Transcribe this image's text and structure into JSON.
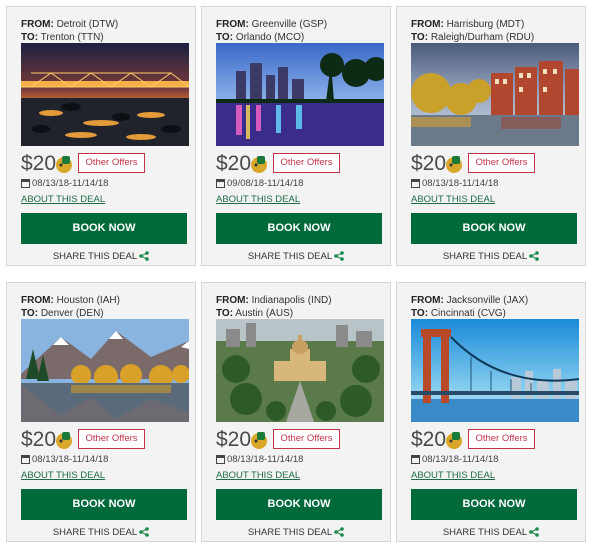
{
  "labels": {
    "from": "FROM:",
    "to": "TO:",
    "other_offers": "Other Offers",
    "about": "ABOUT THIS DEAL",
    "book": "BOOK NOW",
    "share": "SHARE THIS DEAL"
  },
  "colors": {
    "book_button": "#006a3a",
    "offers_border": "#c3344a",
    "about_link": "#1e6b46",
    "share_icon": "#1a8a4a",
    "card_bg": "#f3f3f3"
  },
  "deals": [
    {
      "from": "Detroit (DTW)",
      "to": "Trenton (TTN)",
      "price": "$20",
      "dates": "08/13/18-11/14/18",
      "photo": "bridge-sunset"
    },
    {
      "from": "Greenville (GSP)",
      "to": "Orlando (MCO)",
      "price": "$20",
      "dates": "09/08/18-11/14/18",
      "photo": "city-night-lake"
    },
    {
      "from": "Harrisburg (MDT)",
      "to": "Raleigh/Durham (RDU)",
      "price": "$20",
      "dates": "08/13/18-11/14/18",
      "photo": "riverside-buildings"
    },
    {
      "from": "Houston (IAH)",
      "to": "Denver (DEN)",
      "price": "$20",
      "dates": "08/13/18-11/14/18",
      "photo": "mountain-lake-autumn"
    },
    {
      "from": "Indianapolis (IND)",
      "to": "Austin (AUS)",
      "price": "$20",
      "dates": "08/13/18-11/14/18",
      "photo": "capitol-aerial"
    },
    {
      "from": "Jacksonville (JAX)",
      "to": "Cincinnati (CVG)",
      "price": "$20",
      "dates": "08/13/18-11/14/18",
      "photo": "suspension-bridge"
    }
  ]
}
